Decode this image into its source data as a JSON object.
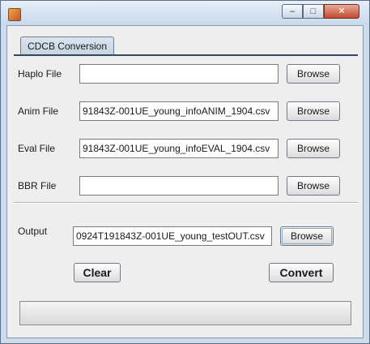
{
  "window": {
    "title": "",
    "controls": {
      "minimize": "‒",
      "maximize": "□",
      "close": "✕"
    }
  },
  "tab": {
    "label": "CDCB Conversion"
  },
  "rows": {
    "haplo": {
      "label": "Haplo File",
      "value": "",
      "button": "Browse"
    },
    "anim": {
      "label": "Anim File",
      "value": "91843Z-001UE_young_infoANIM_1904.csv",
      "button": "Browse"
    },
    "eval": {
      "label": "Eval File",
      "value": "91843Z-001UE_young_infoEVAL_1904.csv",
      "button": "Browse"
    },
    "bbr": {
      "label": "BBR File",
      "value": "",
      "button": "Browse"
    },
    "output": {
      "label": "Output",
      "value": "0924T191843Z-001UE_young_testOUT.csv",
      "button": "Browse"
    }
  },
  "actions": {
    "clear": "Clear",
    "convert": "Convert"
  },
  "progress": {
    "value": 0
  }
}
